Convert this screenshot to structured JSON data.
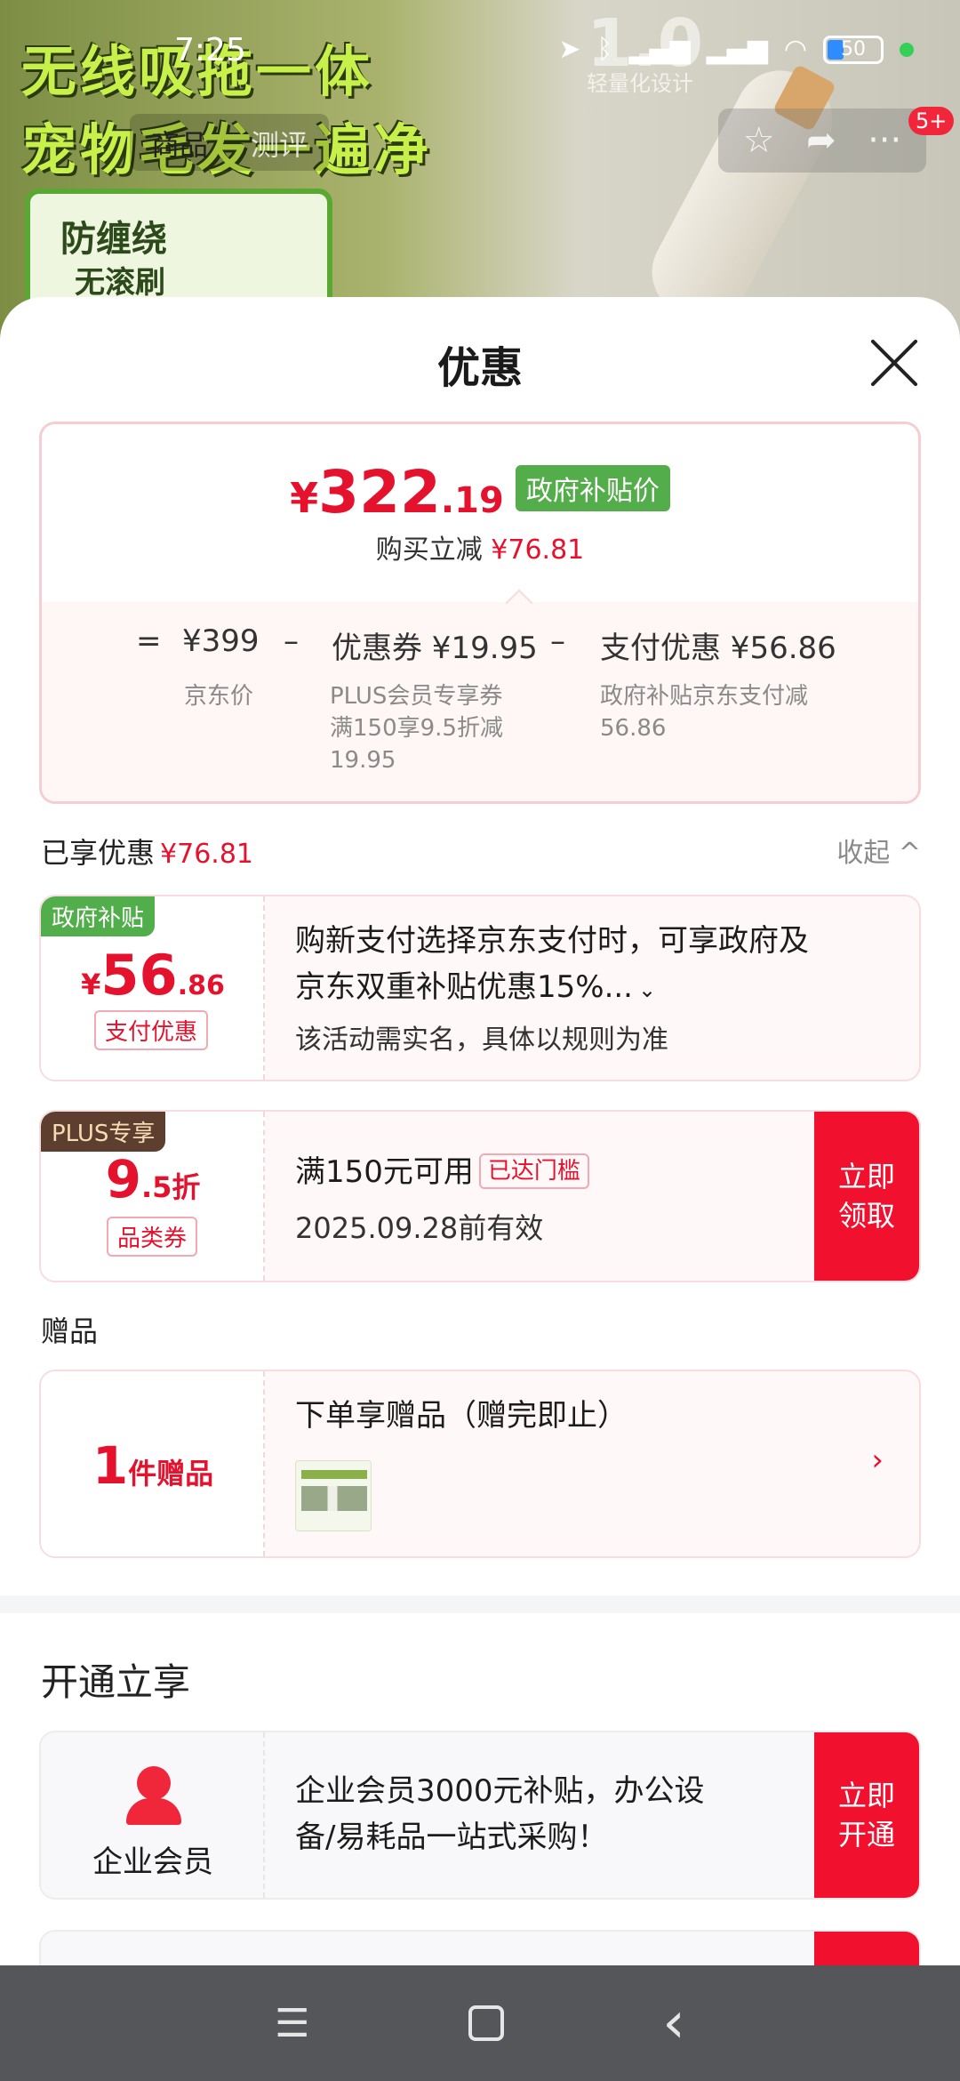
{
  "background": {
    "headline_line1": "无线吸拖一体",
    "headline_line2": "宠物毛发一遍净",
    "badge_line1": "防缠绕",
    "badge_line2": "无滚刷",
    "weight_big": "1.0",
    "weight_small": "轻量化设计",
    "tabs": [
      "商品",
      "测评"
    ],
    "notification_badge": "5+"
  },
  "status_bar": {
    "time": "7:25",
    "battery": "50"
  },
  "sheet": {
    "title": "优惠",
    "price": {
      "yen": "¥",
      "integer": "322",
      "decimal": ".19",
      "tag": "政府补贴价",
      "discount_label": "购买立减",
      "discount_value": "¥76.81"
    },
    "breakdown": {
      "eq": "=",
      "jd_price": "¥399",
      "jd_price_label": "京东价",
      "minus1": "–",
      "coupon": "优惠券 ¥19.95",
      "coupon_note_1": "PLUS会员专享券",
      "coupon_note_2": "满150享9.5折减",
      "coupon_note_3": "19.95",
      "minus2": "–",
      "pay": "支付优惠 ¥56.86",
      "pay_note_1": "政府补贴京东支付减",
      "pay_note_2": "56.86"
    },
    "enjoyed": {
      "label": "已享优惠",
      "value": "¥76.81",
      "collapse": "收起 ^"
    },
    "gov_card": {
      "corner": "政府补贴",
      "yen": "¥",
      "amount": "56",
      "decimal": ".86",
      "type": "支付优惠",
      "desc_line1": "购新支付选择京东支付时，可享政府及",
      "desc_line2": "京东双重补贴优惠15%...",
      "desc_sub": "该活动需实名，具体以规则为准"
    },
    "plus_card": {
      "corner": "PLUS专享",
      "discount": "9",
      "discount_dec": ".5折",
      "type": "品类券",
      "condition": "满150元可用",
      "threshold": "已达门槛",
      "expiry": "2025.09.28前有效",
      "button_line1": "立即",
      "button_line2": "领取"
    },
    "gifts": {
      "section_label": "赠品",
      "count": "1",
      "count_label": "件赠品",
      "title": "下单享赠品（赠完即止）",
      "arrow": "›"
    },
    "open": {
      "section_label": "开通立享",
      "member_label": "企业会员",
      "desc_line1": "企业会员3000元补贴，办公设",
      "desc_line2": "备/易耗品一站式采购！",
      "button_line1": "立即",
      "button_line2": "开通"
    }
  },
  "navbar": {
    "menu": "☰",
    "back": "‹"
  },
  "colors": {
    "accent_red": "#e5122e",
    "gov_green": "#53ad4a",
    "plus_brown": "#5e3f2f"
  }
}
